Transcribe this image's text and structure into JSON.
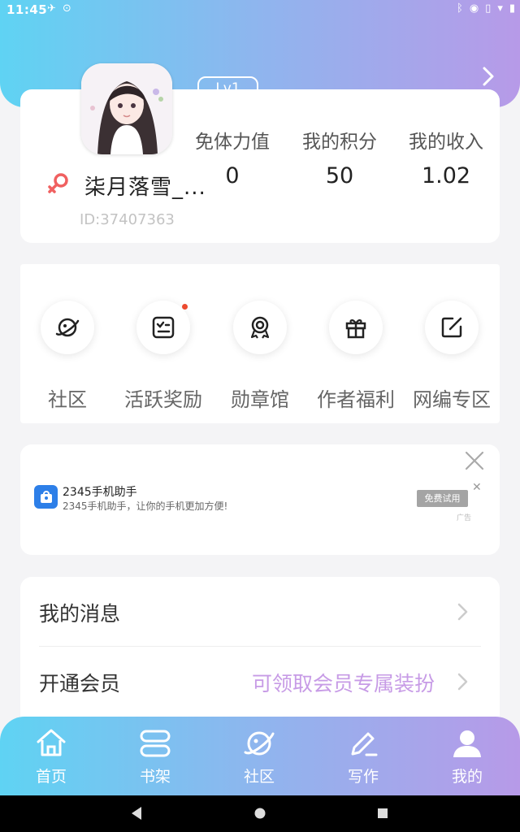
{
  "status_bar": {
    "time": "11:45"
  },
  "profile": {
    "level": "Lv1",
    "username": "柒月落雪_...",
    "user_id": "ID:37407363",
    "stats": [
      {
        "label": "免体力值",
        "value": "0"
      },
      {
        "label": "我的积分",
        "value": "50"
      },
      {
        "label": "我的收入",
        "value": "1.02"
      }
    ]
  },
  "quick_actions": [
    {
      "label": "社区",
      "icon": "planet-icon"
    },
    {
      "label": "活跃奖励",
      "icon": "checklist-icon",
      "badge": true
    },
    {
      "label": "勋章馆",
      "icon": "medal-icon"
    },
    {
      "label": "作者福利",
      "icon": "gift-icon"
    },
    {
      "label": "网编专区",
      "icon": "edit-square-icon"
    }
  ],
  "ad": {
    "title": "2345手机助手",
    "description": "2345手机助手，让你的手机更加方便!",
    "cta": "免费试用",
    "mark": "广告"
  },
  "menu": [
    {
      "label": "我的消息",
      "extra": ""
    },
    {
      "label": "开通会员",
      "extra": "可领取会员专属装扮"
    }
  ],
  "tabs": [
    {
      "label": "首页",
      "icon": "home-icon"
    },
    {
      "label": "书架",
      "icon": "bookshelf-icon"
    },
    {
      "label": "社区",
      "icon": "planet-icon"
    },
    {
      "label": "写作",
      "icon": "pen-icon"
    },
    {
      "label": "我的",
      "icon": "user-icon",
      "active": true
    }
  ],
  "colors": {
    "gradient_start": "#5fd3f3",
    "gradient_end": "#b79ae8",
    "accent_purple": "#c79be6",
    "badge_red": "#ec4a2f",
    "gender_red": "#f06060"
  }
}
